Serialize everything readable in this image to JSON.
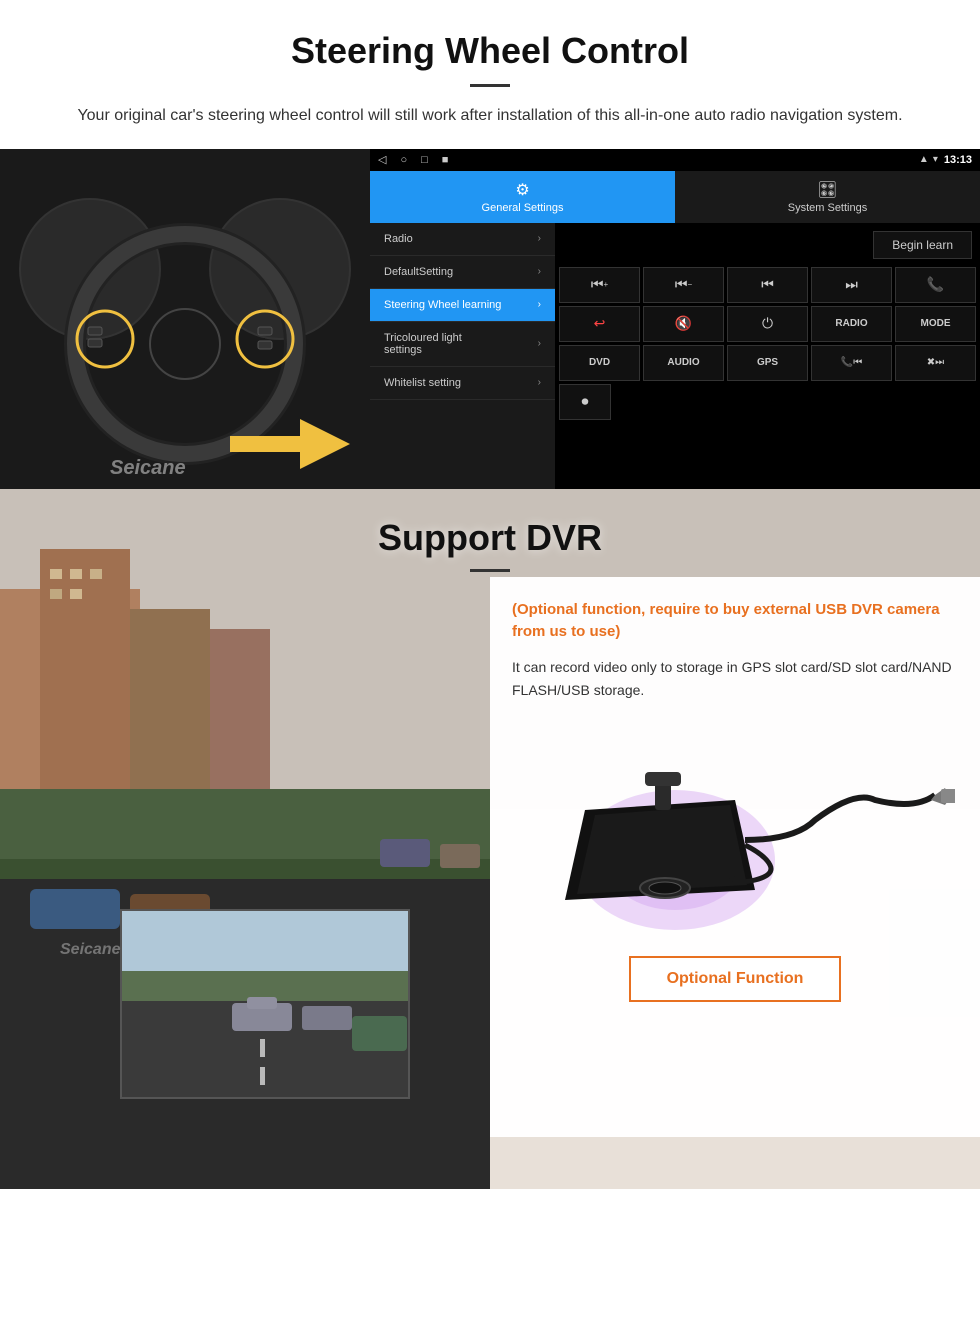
{
  "page": {
    "header": {
      "title": "Steering Wheel Control",
      "subtitle": "Your original car's steering wheel control will still work after installation of this all-in-one auto radio navigation system."
    },
    "android_ui": {
      "statusbar": {
        "time": "13:13",
        "nav_icons": [
          "◁",
          "○",
          "□",
          "■"
        ]
      },
      "tabs": {
        "general": {
          "label": "General Settings",
          "icon": "⚙"
        },
        "system": {
          "label": "System Settings",
          "icon": "🎛"
        }
      },
      "menu_items": [
        {
          "label": "Radio",
          "active": false
        },
        {
          "label": "DefaultSetting",
          "active": false
        },
        {
          "label": "Steering Wheel learning",
          "active": true
        },
        {
          "label": "Tricoloured light settings",
          "active": false
        },
        {
          "label": "Whitelist setting",
          "active": false
        }
      ],
      "begin_learn_label": "Begin learn",
      "control_buttons": {
        "row1": [
          "⏮+",
          "⏮-",
          "⏮",
          "⏭",
          "📞"
        ],
        "row2": [
          "↩",
          "🔇",
          "⏻",
          "RADIO",
          "MODE"
        ],
        "row3": [
          "DVD",
          "AUDIO",
          "GPS",
          "📞⏮",
          "✖⏭"
        ],
        "row4": [
          "⏺"
        ]
      }
    },
    "dvr_section": {
      "title": "Support DVR",
      "optional_notice": "(Optional function, require to buy external USB DVR camera from us to use)",
      "description": "It can record video only to storage in GPS slot card/SD slot card/NAND FLASH/USB storage.",
      "optional_button_label": "Optional Function"
    }
  }
}
